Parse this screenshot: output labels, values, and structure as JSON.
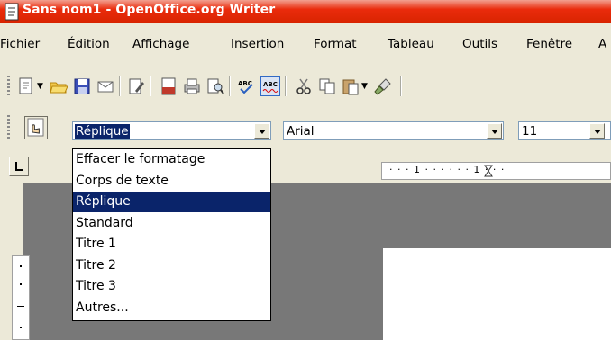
{
  "window": {
    "title": "Sans nom1 - OpenOffice.org Writer"
  },
  "menu": [
    {
      "pre": "",
      "ul": "F",
      "post": "ichier"
    },
    {
      "pre": "",
      "ul": "É",
      "post": "dition"
    },
    {
      "pre": "",
      "ul": "A",
      "post": "ffichage"
    },
    {
      "pre": "",
      "ul": "I",
      "post": "nsertion"
    },
    {
      "pre": "Forma",
      "ul": "t",
      "post": ""
    },
    {
      "pre": "Ta",
      "ul": "b",
      "post": "leau"
    },
    {
      "pre": "",
      "ul": "O",
      "post": "utils"
    },
    {
      "pre": "Fe",
      "ul": "n",
      "post": "être"
    },
    {
      "pre": "A",
      "ul": "",
      "post": ""
    }
  ],
  "toolbar": {
    "style_value": "Réplique",
    "font_value": "Arial",
    "size_value": "11"
  },
  "ruler": {
    "h_marks": "· · · 1 · · · · · · 1 · · ·"
  },
  "style_dropdown": {
    "items": [
      "Effacer le formatage",
      "Corps de texte",
      "Réplique",
      "Standard",
      "Titre 1",
      "Titre 2",
      "Titre 3",
      "Autres..."
    ],
    "selected": "Réplique"
  },
  "colors": {
    "title_bar": "#ea2b0c",
    "selection": "#0a246a",
    "workspace": "#787878"
  }
}
